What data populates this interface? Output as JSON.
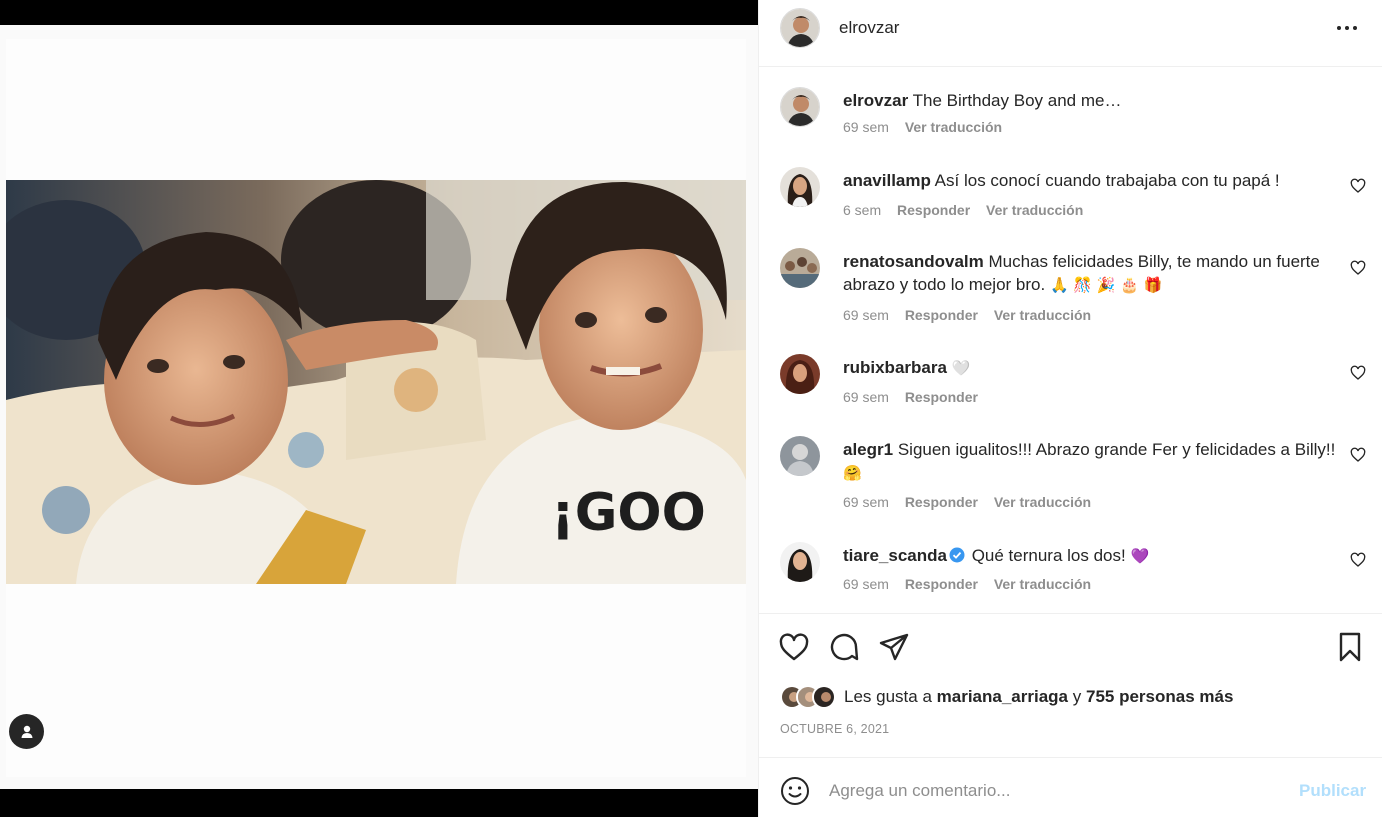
{
  "post": {
    "author": "elrovzar",
    "caption": "The Birthday Boy and me…",
    "caption_time": "69 sem",
    "caption_translate": "Ver traducción",
    "photo_shirt_text": "¡GOO"
  },
  "header": {
    "username": "elrovzar",
    "more_icon": "more-horizontal-icon"
  },
  "comments": [
    {
      "user": "anavillamp",
      "text": "Así los conocí cuando trabajaba con tu papá !",
      "time": "6 sem",
      "reply": "Responder",
      "translate": "Ver traducción",
      "verified": false,
      "emoji": ""
    },
    {
      "user": "renatosandovalm",
      "text": "Muchas felicidades Billy, te mando un fuerte abrazo y todo lo mejor bro.",
      "emoji": "🙏 🎊 🎉 🎂 🎁",
      "time": "69 sem",
      "reply": "Responder",
      "translate": "Ver traducción",
      "verified": false
    },
    {
      "user": "rubixbarbara",
      "text": "",
      "emoji": "🤍",
      "time": "69 sem",
      "reply": "Responder",
      "translate": "",
      "verified": false
    },
    {
      "user": "alegr1",
      "text": "Siguen igualitos!!! Abrazo grande Fer y felicidades a Billy!!",
      "emoji": "🤗",
      "time": "69 sem",
      "reply": "Responder",
      "translate": "Ver traducción",
      "verified": false
    },
    {
      "user": "tiare_scanda",
      "text": "Qué ternura los dos!",
      "emoji": "💜",
      "time": "69 sem",
      "reply": "Responder",
      "translate": "Ver traducción",
      "verified": true
    }
  ],
  "likes": {
    "prefix": "Les gusta a",
    "user": "mariana_arriaga",
    "joiner": "y",
    "others": "755 personas más"
  },
  "date": "OCTUBRE 6, 2021",
  "comment_box": {
    "placeholder": "Agrega un comentario...",
    "publish": "Publicar"
  },
  "colors": {
    "accent_disabled": "#b2dffc",
    "secondary_text": "#8e8e8e",
    "verified": "#3897f0"
  }
}
